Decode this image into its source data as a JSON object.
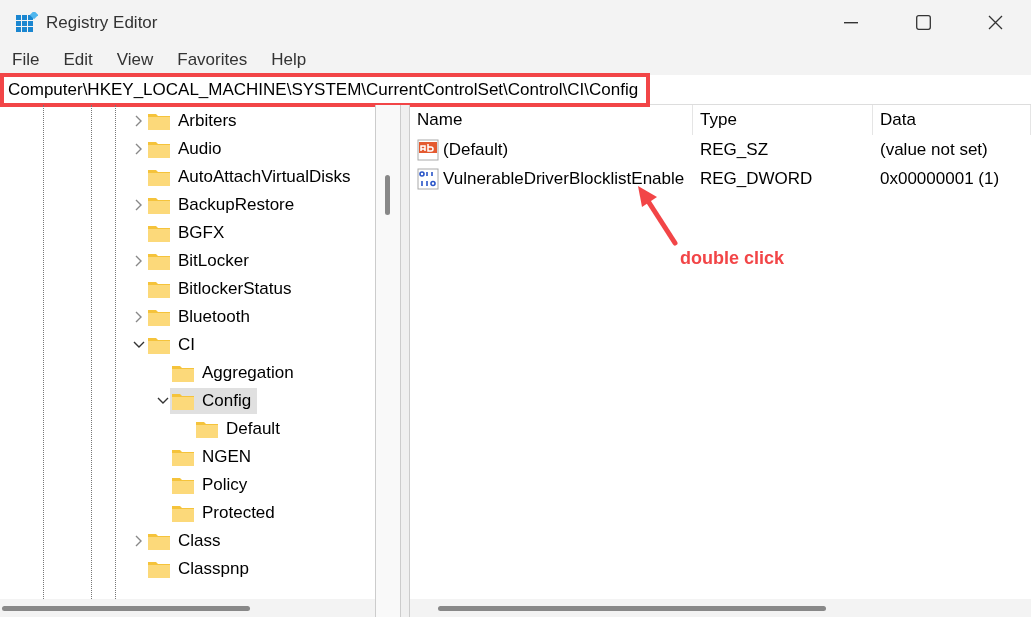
{
  "window": {
    "title": "Registry Editor"
  },
  "menu": [
    "File",
    "Edit",
    "View",
    "Favorites",
    "Help"
  ],
  "address_bar": {
    "value": "Computer\\HKEY_LOCAL_MACHINE\\SYSTEM\\CurrentControlSet\\Control\\CI\\Config",
    "highlighted": true
  },
  "tree": {
    "items": [
      {
        "label": "Arbiters",
        "kind": "branch",
        "expanded": false,
        "selected": false
      },
      {
        "label": "Audio",
        "kind": "branch",
        "expanded": false,
        "selected": false
      },
      {
        "label": "AutoAttachVirtualDisks",
        "kind": "leaf",
        "selected": false
      },
      {
        "label": "BackupRestore",
        "kind": "branch",
        "expanded": false,
        "selected": false
      },
      {
        "label": "BGFX",
        "kind": "leaf",
        "selected": false
      },
      {
        "label": "BitLocker",
        "kind": "branch",
        "expanded": false,
        "selected": false
      },
      {
        "label": "BitlockerStatus",
        "kind": "leaf",
        "selected": false
      },
      {
        "label": "Bluetooth",
        "kind": "branch",
        "expanded": false,
        "selected": false
      },
      {
        "label": "CI",
        "kind": "branch",
        "expanded": true,
        "selected": false,
        "children": [
          {
            "label": "Aggregation",
            "kind": "leaf",
            "selected": false
          },
          {
            "label": "Config",
            "kind": "branch",
            "expanded": true,
            "selected": true,
            "children": [
              {
                "label": "Default",
                "kind": "leaf",
                "selected": false
              }
            ]
          },
          {
            "label": "NGEN",
            "kind": "leaf",
            "selected": false
          },
          {
            "label": "Policy",
            "kind": "leaf",
            "selected": false
          },
          {
            "label": "Protected",
            "kind": "leaf",
            "selected": false
          }
        ]
      },
      {
        "label": "Class",
        "kind": "branch",
        "expanded": false,
        "selected": false
      },
      {
        "label": "Classpnp",
        "kind": "leaf",
        "selected": false
      }
    ]
  },
  "values": {
    "columns": [
      "Name",
      "Type",
      "Data"
    ],
    "rows": [
      {
        "kind": "string",
        "name": "(Default)",
        "type": "REG_SZ",
        "data": "(value not set)"
      },
      {
        "kind": "binary",
        "name": "VulnerableDriverBlocklistEnable",
        "type": "REG_DWORD",
        "data": "0x00000001 (1)"
      }
    ]
  },
  "annotation": {
    "text": "double click"
  }
}
